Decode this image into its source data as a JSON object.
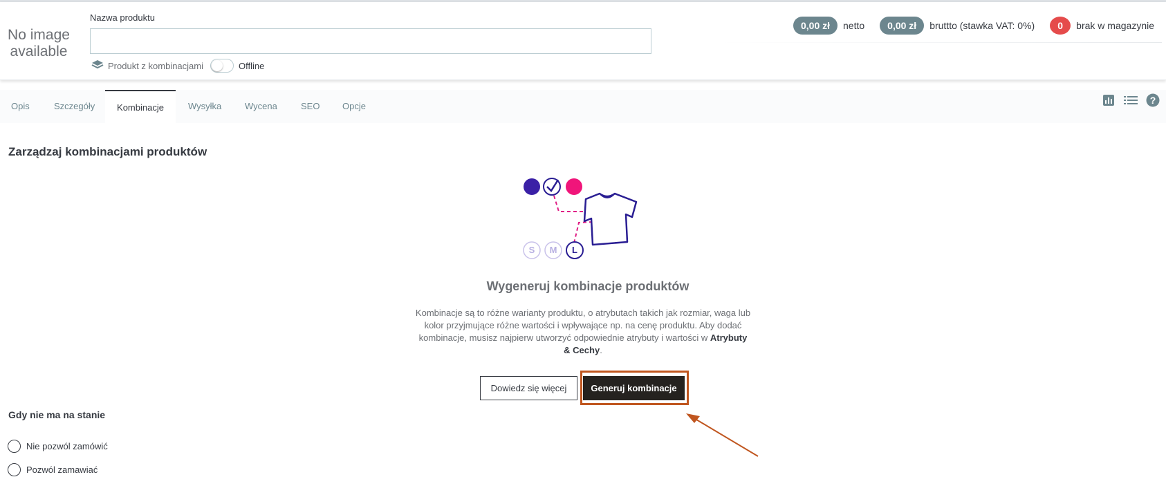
{
  "header": {
    "no_image_text": "No image available",
    "name_label": "Nazwa produktu",
    "name_value": "",
    "combinations_flag": "Produkt z kombinacjami",
    "offline_label": "Offline",
    "offline_enabled": false,
    "price_net": "0,00 zł",
    "net_label": "netto",
    "price_gross": "0,00 zł",
    "gross_label": "bruttto (stawka VAT: 0%)",
    "stock_count": "0",
    "stock_label": "brak w magazynie"
  },
  "tabs": [
    {
      "label": "Opis",
      "active": false
    },
    {
      "label": "Szczegóły",
      "active": false
    },
    {
      "label": "Kombinacje",
      "active": true
    },
    {
      "label": "Wysyłka",
      "active": false
    },
    {
      "label": "Wycena",
      "active": false
    },
    {
      "label": "SEO",
      "active": false
    },
    {
      "label": "Opcje",
      "active": false
    }
  ],
  "tools": [
    {
      "icon": "chart-icon"
    },
    {
      "icon": "list-icon"
    },
    {
      "icon": "help-icon"
    }
  ],
  "main": {
    "title": "Zarządzaj kombinacjami produktów",
    "illustration": {
      "sizes": [
        "S",
        "M",
        "L"
      ],
      "colors": {
        "dot1": "#3a20a6",
        "dot3": "#f0157a",
        "line": "#e01f86",
        "stroke": "#2a1e93"
      }
    },
    "empty_title": "Wygeneruj kombinacje produktów",
    "empty_desc": "Kombinacje są to różne warianty produktu, o atrybutach takich jak rozmiar, waga lub kolor przyjmujące różne wartości i wpływające np. na cenę produktu. Aby dodać kombinacje, musisz najpierw utworzyć odpowiednie atrybuty i wartości w ",
    "empty_desc_link": "Atrybuty & Cechy",
    "empty_desc_end": ".",
    "learn_more_button": "Dowiedz się więcej",
    "generate_button": "Generuj kombinacje"
  },
  "stock": {
    "title": "Gdy nie ma na stanie",
    "options": [
      "Nie pozwól zamówić",
      "Pozwól zamawiać"
    ]
  },
  "colors": {
    "highlight": "#c0561f",
    "pill": "#6c868e",
    "pill_red": "#e54b4b",
    "dark_button": "#25221f"
  }
}
